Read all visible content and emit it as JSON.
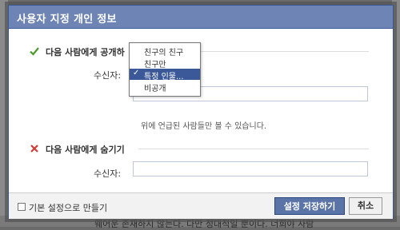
{
  "dialog": {
    "title": "사용자 지정 개인 정보"
  },
  "share_section": {
    "heading": "다음 사람에게 공개하",
    "recipient_label": "수신자:",
    "recipient_value": "",
    "hint": "위에 언급된 사람들만 볼 수 있습니다."
  },
  "dropdown": {
    "options": [
      {
        "label": "친구의 친구"
      },
      {
        "label": "친구만"
      },
      {
        "label": "특정 인물...",
        "check": "✓"
      },
      {
        "label": "비공개"
      }
    ],
    "selected_index": 2
  },
  "hide_section": {
    "heading": "다음 사람에게 숨기기",
    "recipient_label": "수신자:",
    "recipient_value": ""
  },
  "footer": {
    "default_checkbox_label": "기본 설정으로 만들기",
    "default_checked": false,
    "save_label": "설정 저장하기",
    "cancel_label": "취소"
  },
  "background": {
    "bottom_text": "웨어운 존재하지 않는다. 다만 정대적일 뿐이다. 너희야 사람"
  },
  "colors": {
    "title_bar": "#6d84b4",
    "accent": "#3b5998",
    "check_green": "#4a9b2e",
    "x_red": "#d23a3a"
  }
}
